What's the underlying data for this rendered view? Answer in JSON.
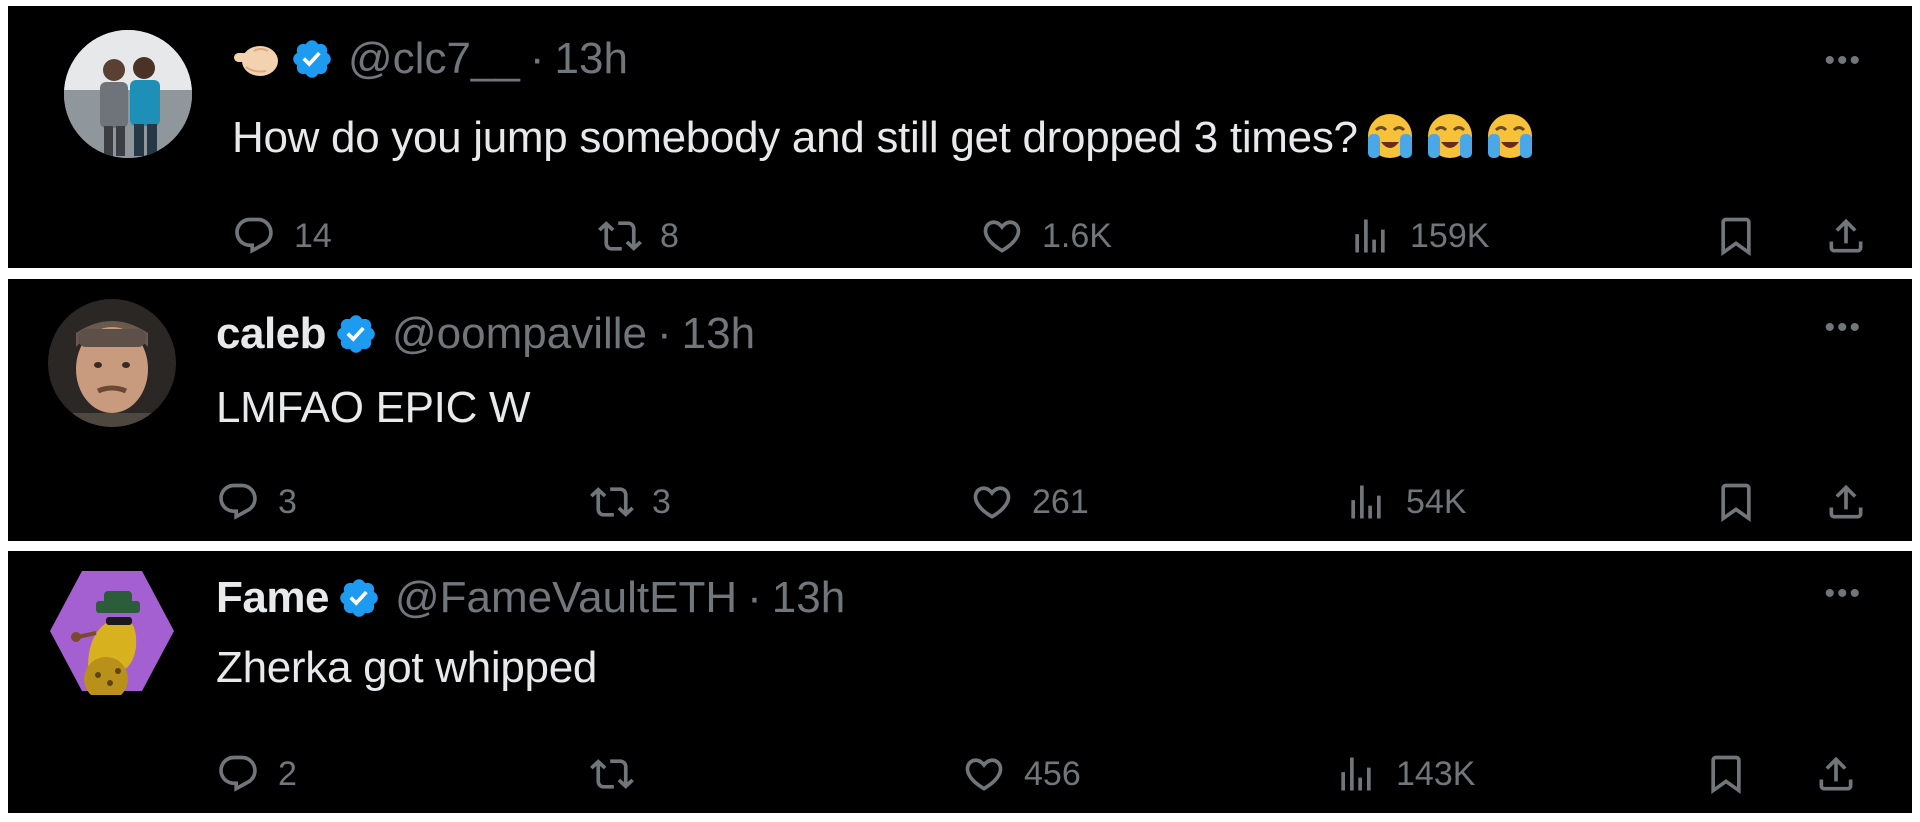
{
  "tweets": [
    {
      "name": "",
      "name_emoji": "pointing-hand-emoji",
      "handle": "@clc7__",
      "dot": "·",
      "time": "13h",
      "text": "How do you jump somebody and still get dropped 3 times?",
      "text_emojis": [
        "loudly-crying-face-emoji",
        "loudly-crying-face-emoji",
        "loudly-crying-face-emoji"
      ],
      "replies": "14",
      "reposts": "8",
      "likes": "1.6K",
      "views": "159K"
    },
    {
      "name": "caleb",
      "handle": "@oompaville",
      "dot": "·",
      "time": "13h",
      "text": "LMFAO EPIC W",
      "replies": "3",
      "reposts": "3",
      "likes": "261",
      "views": "54K"
    },
    {
      "name": "Fame",
      "handle": "@FameVaultETH",
      "dot": "·",
      "time": "13h",
      "text": "Zherka got whipped",
      "replies": "2",
      "reposts": "",
      "likes": "456",
      "views": "143K"
    }
  ],
  "more_label": "•••",
  "colors": {
    "background": "#000000",
    "text": "#e7e9ea",
    "muted": "#71767b",
    "verified": "#1d9bf0"
  },
  "icons": [
    "reply-icon",
    "repost-icon",
    "like-icon",
    "views-icon",
    "bookmark-icon",
    "share-icon",
    "more-icon",
    "verified-badge-icon"
  ]
}
